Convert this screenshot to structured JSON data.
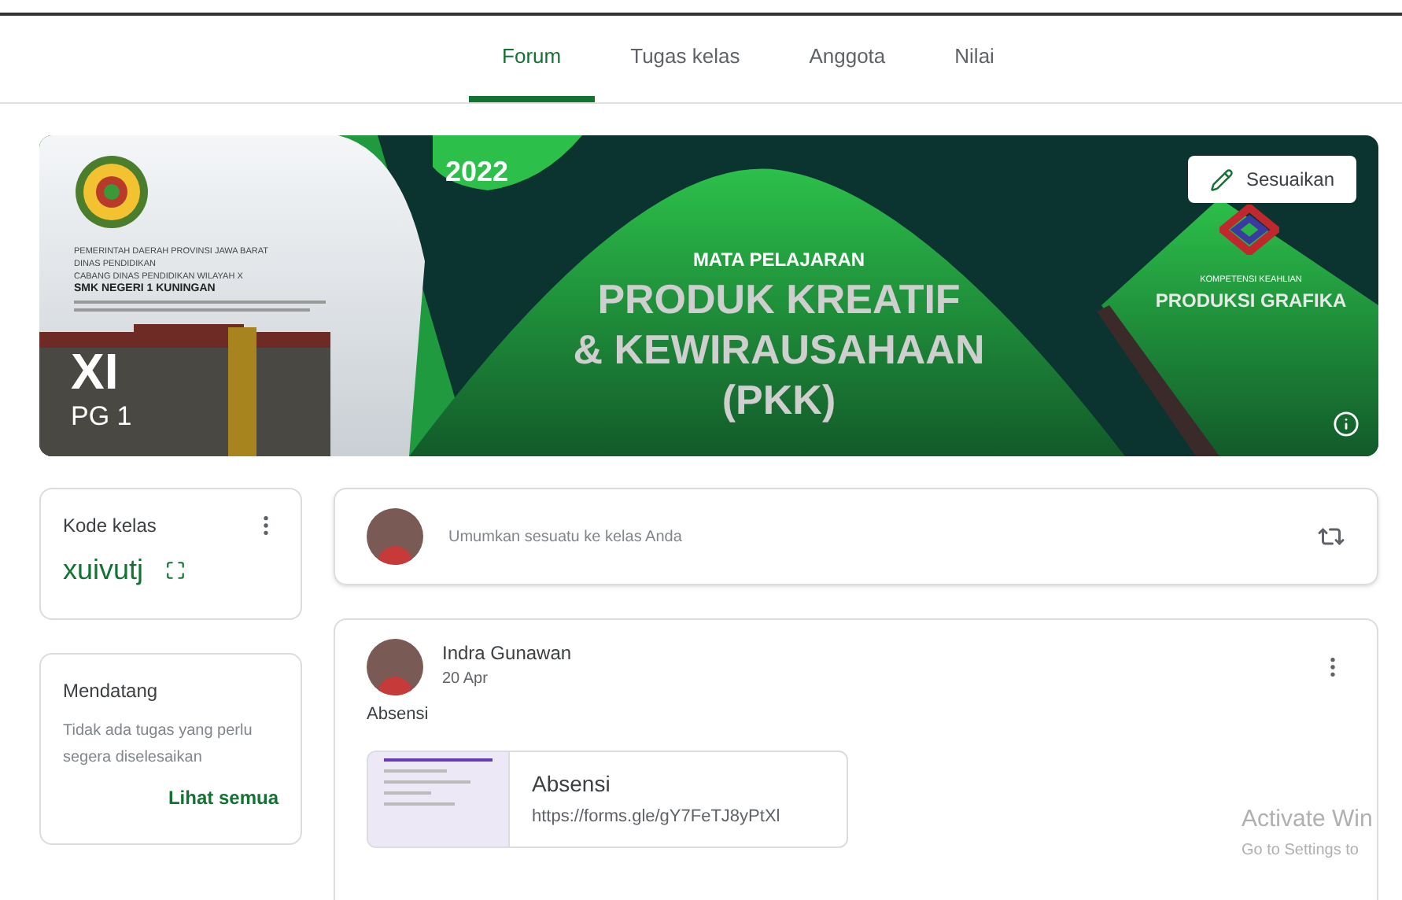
{
  "tabs": [
    {
      "label": "Forum",
      "selected": true
    },
    {
      "label": "Tugas kelas",
      "selected": false
    },
    {
      "label": "Anggota",
      "selected": false
    },
    {
      "label": "Nilai",
      "selected": false
    }
  ],
  "banner": {
    "school_lines": [
      "PEMERINTAH DAERAH PROVINSI JAWA BARAT",
      "DINAS PENDIDIKAN",
      "CABANG DINAS PENDIDIKAN WILAYAH X"
    ],
    "school_name": "SMK NEGERI 1 KUNINGAN",
    "year": "2022",
    "subject_label": "MATA PELAJARAN",
    "subject_lines": [
      "PRODUK KREATIF",
      "& KEWIRAUSAHAAN",
      "(PKK)"
    ],
    "competency_label": "KOMPETENSI KEAHLIAN",
    "competency": "PRODUKSI GRAFIKA",
    "class_name": "XI",
    "section": "PG 1",
    "customize_button": "Sesuaikan"
  },
  "class_code": {
    "label": "Kode kelas",
    "code": "xuivutj"
  },
  "upcoming": {
    "title": "Mendatang",
    "message": "Tidak ada tugas yang perlu segera diselesaikan",
    "link": "Lihat semua"
  },
  "announce": {
    "placeholder": "Umumkan sesuatu ke kelas Anda"
  },
  "post": {
    "author": "Indra Gunawan",
    "date": "20 Apr",
    "text": "Absensi",
    "attachment": {
      "title": "Absensi",
      "url": "https://forms.gle/gY7FeTJ8yPtXl"
    }
  },
  "os_notice": {
    "title": "Activate Win",
    "subtitle": "Go to Settings to"
  }
}
